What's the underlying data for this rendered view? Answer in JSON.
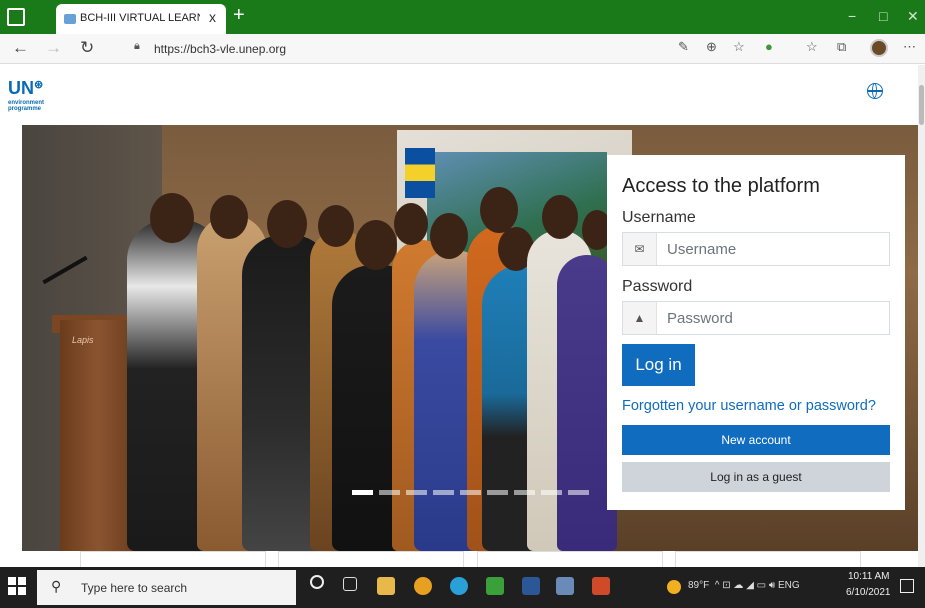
{
  "browser": {
    "tab_title": "BCH-III VIRTUAL LEARNING ENVI",
    "tab_close": "x",
    "new_tab": "+",
    "url": "https://bch3-vle.unep.org",
    "window_controls": [
      "−",
      "□",
      "✕"
    ]
  },
  "site": {
    "logo_main": "UN",
    "logo_sub_lines": [
      "environment",
      "programme"
    ]
  },
  "login": {
    "title": "Access to the platform",
    "username_label": "Username",
    "username_placeholder": "Username",
    "password_label": "Password",
    "password_placeholder": "Password",
    "login_button": "Log in",
    "forgot_link": "Forgotten your username or password?",
    "new_account_button": "New account",
    "guest_button": "Log in as a guest"
  },
  "hero": {
    "podium_label": "Lapis",
    "slide_count": 9,
    "active_slide": 1
  },
  "taskbar": {
    "search_placeholder": "Type here to search",
    "weather": "89°F",
    "language": "ENG",
    "time": "10:11 AM",
    "date": "6/10/2021"
  },
  "colors": {
    "browser_green": "#1a7a1a",
    "primary_blue": "#0f6cbf",
    "secondary_gray": "#ced4da"
  }
}
